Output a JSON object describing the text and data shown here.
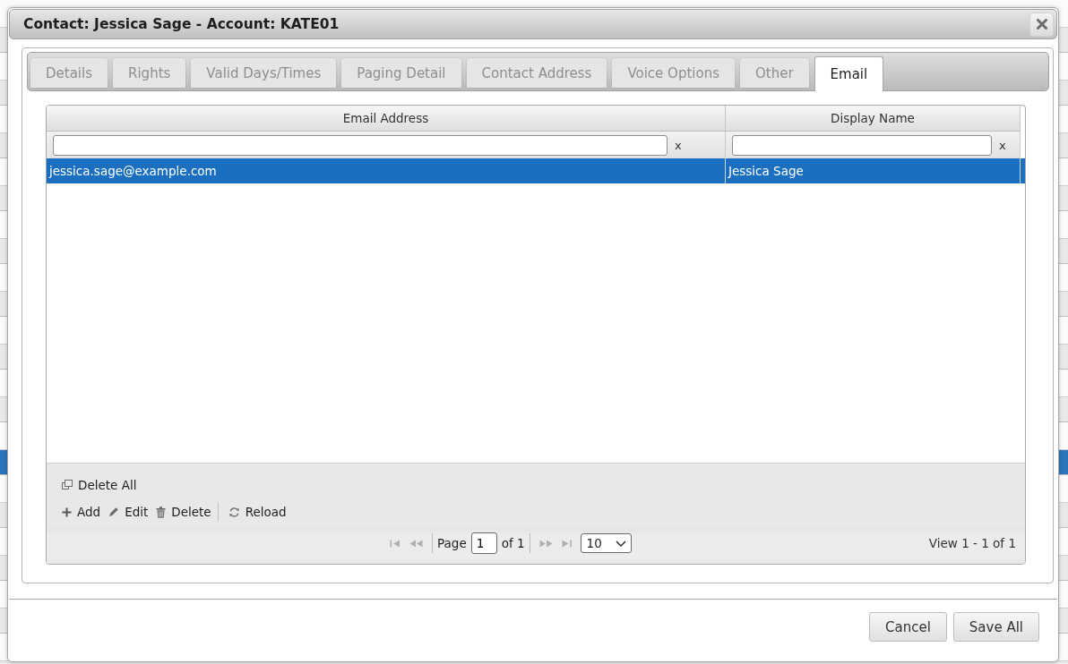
{
  "dialog": {
    "title": "Contact: Jessica Sage - Account: KATE01"
  },
  "tabs": [
    {
      "label": "Details",
      "selected": false
    },
    {
      "label": "Rights",
      "selected": false
    },
    {
      "label": "Valid Days/Times",
      "selected": false
    },
    {
      "label": "Paging Detail",
      "selected": false
    },
    {
      "label": "Contact Address",
      "selected": false
    },
    {
      "label": "Voice Options",
      "selected": false
    },
    {
      "label": "Other",
      "selected": false
    },
    {
      "label": "Email",
      "selected": true
    }
  ],
  "grid": {
    "columns": [
      {
        "label": "Email Address",
        "clear": "x"
      },
      {
        "label": "Display Name",
        "clear": "x"
      }
    ],
    "rows": [
      {
        "cells": [
          "jessica.sage@example.com",
          "Jessica Sage"
        ],
        "selected": true
      }
    ],
    "toolbar": [
      {
        "actions": [
          {
            "kind": "delete-all",
            "label": "Delete All"
          }
        ]
      },
      {
        "actions": [
          {
            "kind": "add",
            "label": "Add"
          },
          {
            "kind": "edit",
            "label": "Edit"
          },
          {
            "kind": "delete",
            "label": "Delete"
          },
          {
            "kind": "reload",
            "label": "Reload"
          }
        ]
      }
    ],
    "pager": {
      "nav_before": [
        {
          "kind": "first",
          "disabled": true
        },
        {
          "kind": "prev",
          "disabled": true
        }
      ],
      "page_label": "Page",
      "page": "1",
      "page_total": "of 1",
      "nav_after": [
        {
          "kind": "next",
          "disabled": true
        },
        {
          "kind": "last",
          "disabled": true
        }
      ],
      "page_size": "10",
      "summary": "View 1 - 1 of 1"
    }
  },
  "buttons": [
    {
      "label": "Cancel"
    },
    {
      "label": "Save All"
    }
  ]
}
